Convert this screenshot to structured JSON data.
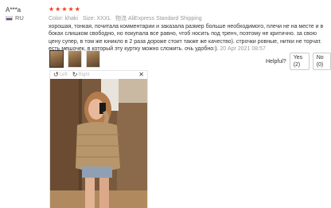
{
  "reviewer": {
    "name": "A***a",
    "country": "RU"
  },
  "rating": {
    "stars": 5
  },
  "meta": {
    "color_label": "Color:",
    "color_value": "khaki",
    "size_label": "Size:",
    "size_value": "XXXL",
    "shipping_icon": "物流",
    "shipping": "AliExpress Standard Shipping"
  },
  "review": {
    "text": "хорошая, тонкая, почитала комментарии и заказала размер больше необходимого, плечи не на месте и в боках слишком свободно, но покупала все равно, чтоб носить под тренч, поэтому не критично. за свою цену супер, в том же юникло в 2 раза дороже стоит также же качество). строчки ровные, нитки не торчат. есть мешочек, в который эту куртку можно сложить. очь удобно:).",
    "date": "20 Apr 2021 08:57"
  },
  "helpful": {
    "label": "Helpful?",
    "yes": "Yes (2)",
    "no": "No (0)"
  },
  "viewer": {
    "left_label": "Left",
    "right_label": "Right",
    "close_glyph": "✕"
  },
  "colors": {
    "star": "#f23b1b",
    "border": "#cccccc",
    "muted": "#999999"
  }
}
